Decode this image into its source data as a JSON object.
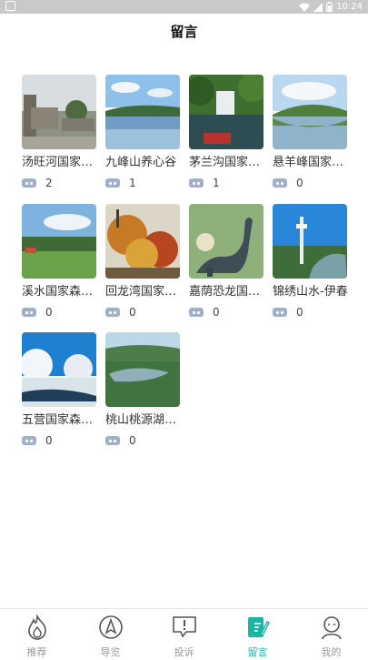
{
  "status_bar": {
    "time": "10:24"
  },
  "header": {
    "title": "留言"
  },
  "cards": [
    {
      "name": "汤旺河国家森林公园",
      "count": "2"
    },
    {
      "name": "九峰山养心谷",
      "count": "1"
    },
    {
      "name": "茅兰沟国家森林公园",
      "count": "1"
    },
    {
      "name": "悬羊峰国家森林公园",
      "count": "0"
    },
    {
      "name": "溪水国家森林公园",
      "count": "0"
    },
    {
      "name": "回龙湾国家森林公园",
      "count": "0"
    },
    {
      "name": "嘉荫恐龙国家地质公园",
      "count": "0"
    },
    {
      "name": "锦绣山水-伊春",
      "count": "0"
    },
    {
      "name": "五营国家森林公园",
      "count": "0"
    },
    {
      "name": "桃山桃源湖景区",
      "count": "0"
    }
  ],
  "tabs": [
    {
      "label": "推荐",
      "icon": "flame-icon"
    },
    {
      "label": "导览",
      "icon": "compass-icon"
    },
    {
      "label": "投诉",
      "icon": "complaint-icon"
    },
    {
      "label": "留言",
      "icon": "message-board-icon"
    },
    {
      "label": "我的",
      "icon": "person-icon"
    }
  ],
  "colors": {
    "accent": "#18b7a5",
    "status_bar": "#c9c9c9",
    "message_icon": "#9fb0c8"
  }
}
